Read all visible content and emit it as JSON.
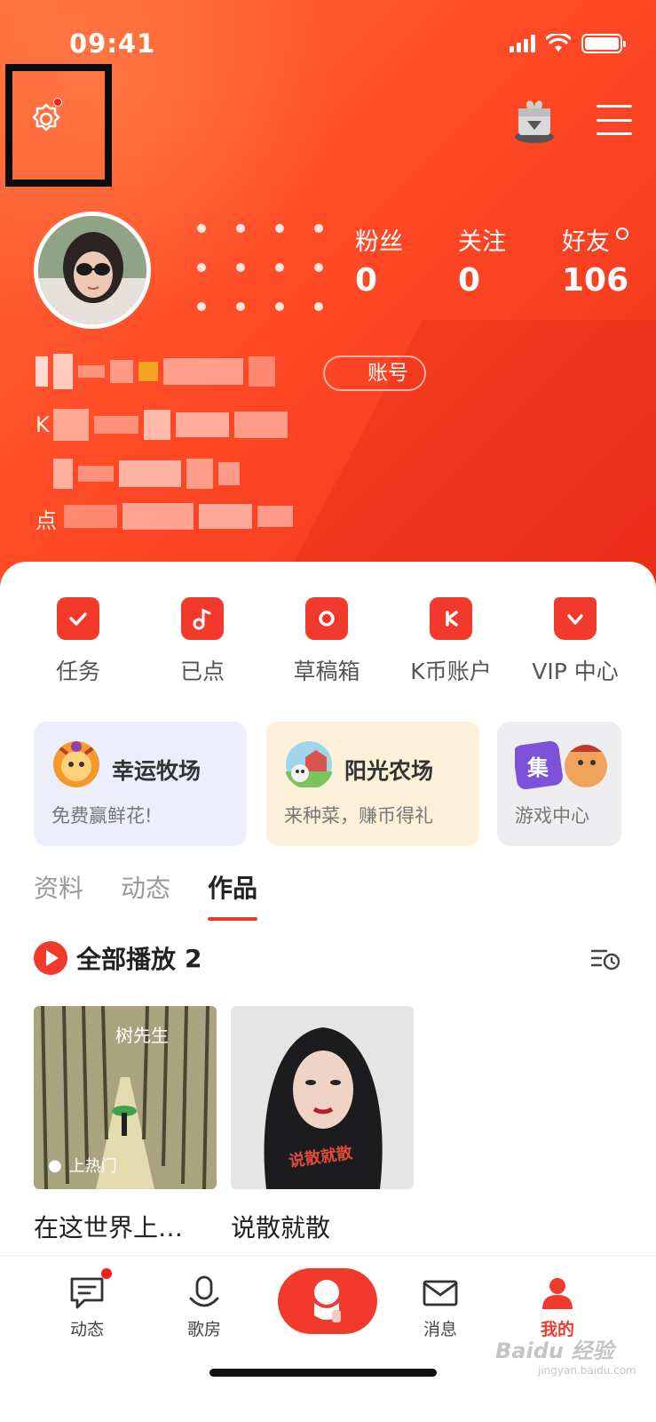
{
  "status_bar": {
    "time": "09:41"
  },
  "profile": {
    "stats": [
      {
        "label": "粉丝",
        "value": "0"
      },
      {
        "label": "关注",
        "value": "0"
      },
      {
        "label": "好友",
        "value": "106"
      }
    ],
    "account_label": "账号",
    "info_prefix_1": "K",
    "info_prefix_3": "点"
  },
  "quick_actions": [
    {
      "label": "任务",
      "icon": "calendar-check-icon"
    },
    {
      "label": "已点",
      "icon": "music-note-icon"
    },
    {
      "label": "草稿箱",
      "icon": "record-icon"
    },
    {
      "label": "K币账户",
      "icon": "k-coin-wallet-icon"
    },
    {
      "label": "VIP 中心",
      "icon": "crown-icon"
    }
  ],
  "game_cards": [
    {
      "title": "幸运牧场",
      "subtitle": "免费赢鲜花!"
    },
    {
      "title": "阳光农场",
      "subtitle": "来种菜，赚币得礼"
    },
    {
      "title": "",
      "subtitle": "游戏中心"
    }
  ],
  "content_tabs": [
    {
      "label": "资料",
      "active": false
    },
    {
      "label": "动态",
      "active": false
    },
    {
      "label": "作品",
      "active": true
    }
  ],
  "works_section": {
    "label": "全部播放",
    "count": "2"
  },
  "works": [
    {
      "title": "在这世界上…",
      "cover_tag": "上热门",
      "cover_title": "树先生"
    },
    {
      "title": "说散就散"
    }
  ],
  "tab_bar": [
    {
      "label": "动态",
      "icon": "message-icon"
    },
    {
      "label": "歌房",
      "icon": "microphone-icon"
    },
    {
      "label": "消息",
      "icon": "envelope-icon"
    },
    {
      "label": "我的",
      "icon": "person-icon",
      "active": true
    }
  ],
  "watermark": {
    "text": "Baidu 经验",
    "sub": "jingyan.baidu.com"
  },
  "colors": {
    "brand_red": "#f23a2c",
    "header_orange": "#ff5a30"
  }
}
